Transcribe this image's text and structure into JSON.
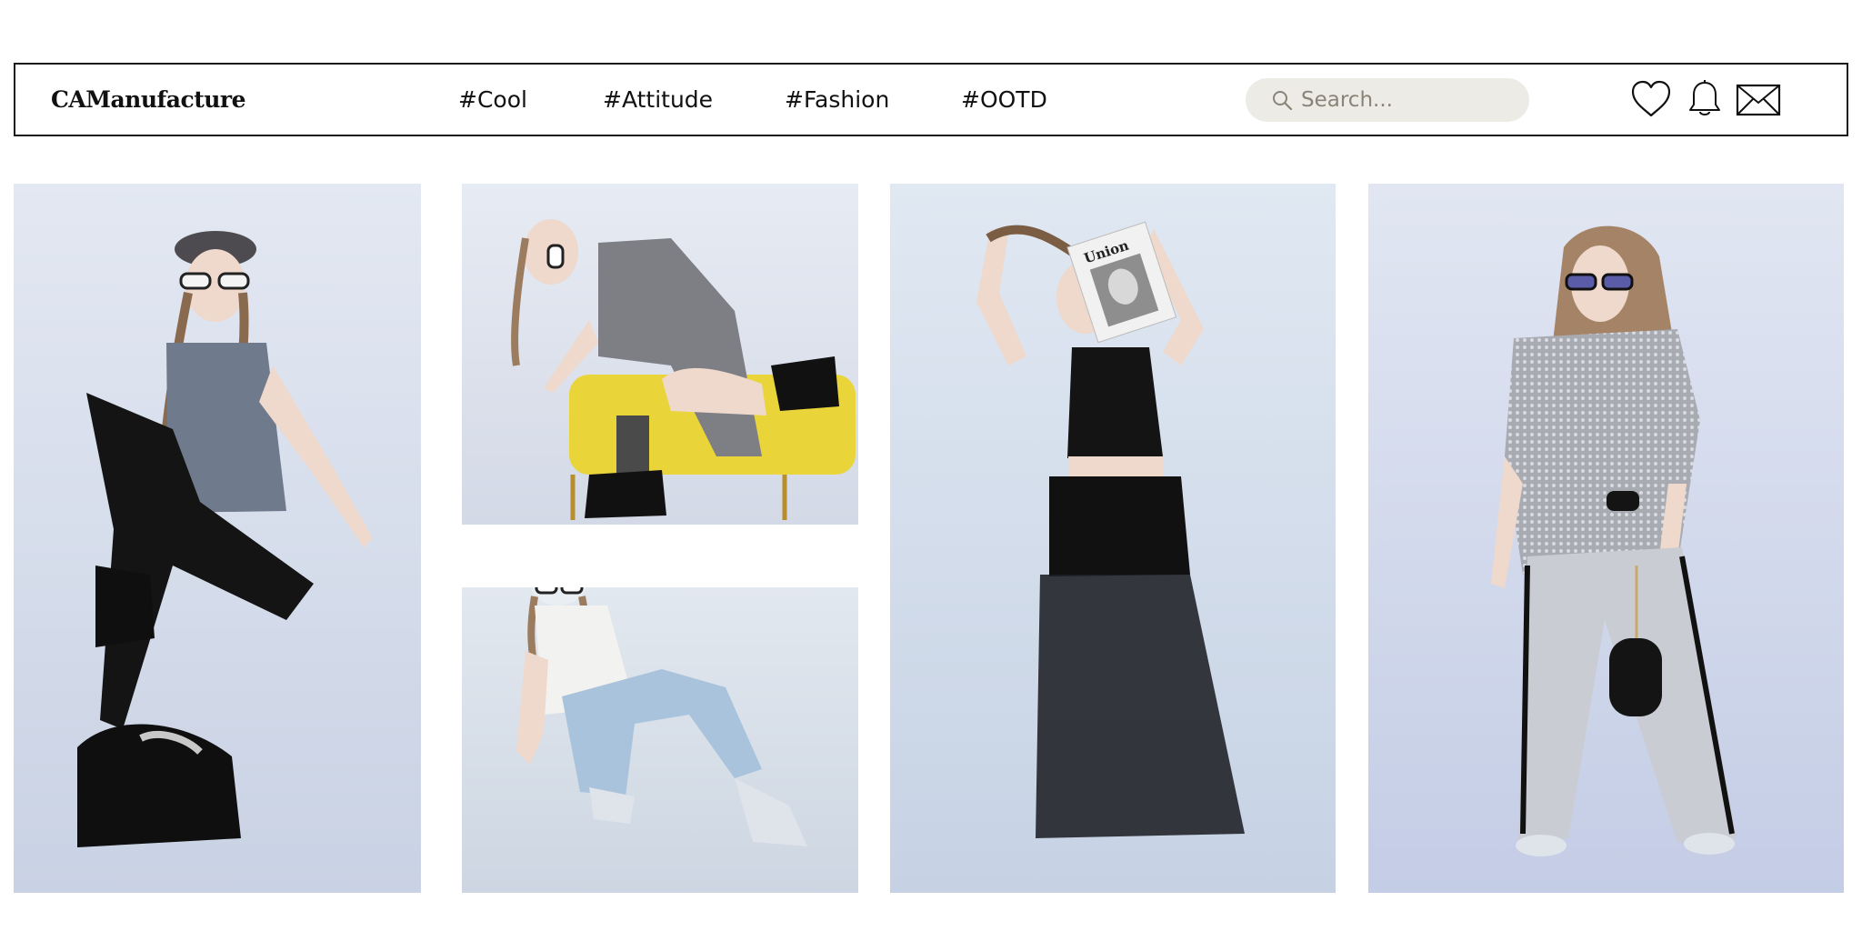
{
  "brand": {
    "name": "CAManufacture"
  },
  "nav": {
    "items": [
      {
        "label": "#Cool"
      },
      {
        "label": "#Attitude"
      },
      {
        "label": "#Fashion"
      },
      {
        "label": "#OOTD"
      }
    ]
  },
  "search": {
    "placeholder": "Search...",
    "value": ""
  },
  "icons": {
    "search": "search-icon",
    "favorites": "heart-icon",
    "notifications": "bell-icon",
    "messages": "envelope-icon"
  },
  "gallery": {
    "photos": [
      {
        "subject": "seated-model-sequin-top-black-trousers"
      },
      {
        "subject": "model-on-yellow-bench-grey-dress"
      },
      {
        "subject": "crouching-model-white-top-distressed-jeans"
      },
      {
        "subject": "model-holding-magazine-black-sheer-skirt"
      },
      {
        "subject": "model-mesh-top-silver-pants"
      }
    ],
    "magazine_title": "Union"
  },
  "colors": {
    "border": "#1a1a1a",
    "search_bg": "#edebe6",
    "photo_bg": "#dde4ee",
    "bench_yellow": "#e9d43a"
  }
}
